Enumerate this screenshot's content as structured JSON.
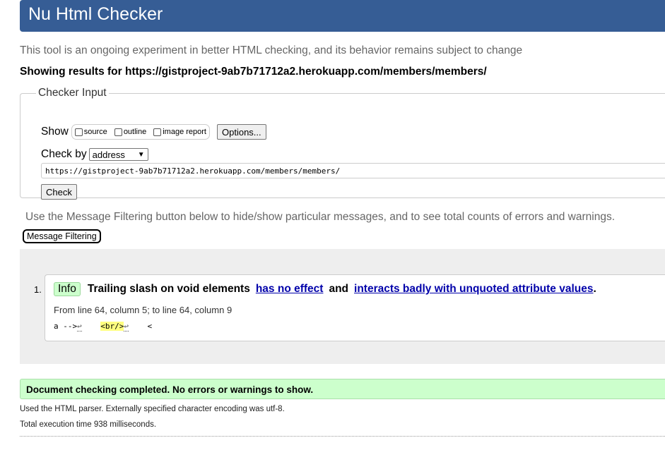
{
  "header": {
    "title": "Nu Html Checker"
  },
  "tagline": "This tool is an ongoing experiment in better HTML checking, and its behavior remains subject to change",
  "showing": "Showing results for https://gistproject-9ab7b71712a2.herokuapp.com/members/members/",
  "checker": {
    "legend": "Checker Input",
    "show_label": "Show",
    "options": [
      {
        "label": "source",
        "checked": false
      },
      {
        "label": "outline",
        "checked": false
      },
      {
        "label": "image report",
        "checked": false
      }
    ],
    "options_button": "Options...",
    "check_by_label": "Check by",
    "check_by_value": "address",
    "url_value": "https://gistproject-9ab7b71712a2.herokuapp.com/members/members/",
    "check_button": "Check"
  },
  "filter": {
    "note": "Use the Message Filtering button below to hide/show particular messages, and to see total counts of errors and warnings.",
    "button": "Message Filtering"
  },
  "messages": [
    {
      "number": "1.",
      "type": "Info",
      "text_before": "Trailing slash on void elements",
      "link1": "has no effect",
      "between": "and",
      "link2": "interacts badly with unquoted attribute values",
      "end": ".",
      "location": "From line 64, column 5; to line 64, column 9",
      "extract": {
        "pre": "a -->",
        "lf1": "↩",
        "gap1": "    ",
        "highlight": "<br/>",
        "lf2": "↩",
        "post": "    <"
      }
    }
  ],
  "summary": {
    "status": "Document checking completed. No errors or warnings to show.",
    "parser": "Used the HTML parser. Externally specified character encoding was utf-8.",
    "execution": "Total execution time 938 milliseconds."
  },
  "colors": {
    "header_bg": "#365d95",
    "success_bg": "#ccffcc",
    "highlight": "#ffff80",
    "link": "#0000aa"
  }
}
